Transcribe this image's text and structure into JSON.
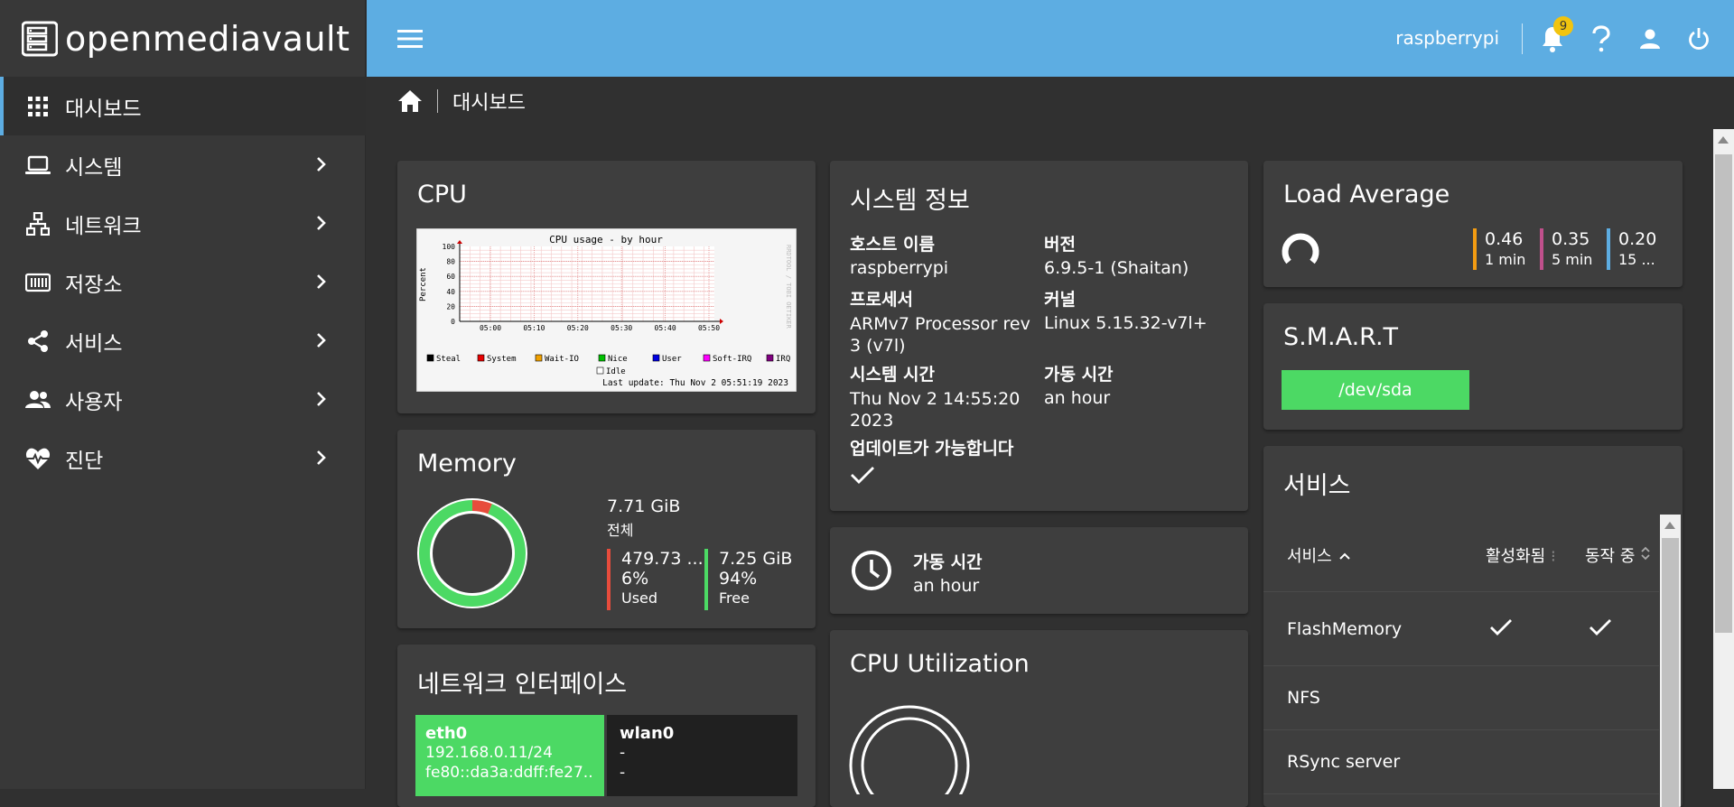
{
  "brand": {
    "name": "openmediavault"
  },
  "sidebar": {
    "items": [
      {
        "label": "대시보드",
        "icon": "grid-icon",
        "active": true,
        "chevron": false
      },
      {
        "label": "시스템",
        "icon": "laptop-icon",
        "chevron": true
      },
      {
        "label": "네트워크",
        "icon": "network-icon",
        "chevron": true
      },
      {
        "label": "저장소",
        "icon": "storage-icon",
        "chevron": true
      },
      {
        "label": "서비스",
        "icon": "share-icon",
        "chevron": true
      },
      {
        "label": "사용자",
        "icon": "users-icon",
        "chevron": true
      },
      {
        "label": "진단",
        "icon": "heartbeat-icon",
        "chevron": true
      }
    ]
  },
  "topbar": {
    "username": "raspberrypi",
    "notifications": "9"
  },
  "breadcrumb": {
    "page": "대시보드"
  },
  "cpu": {
    "title": "CPU",
    "graph_title": "CPU usage - by hour",
    "ylabel": "Percent",
    "side_label": "RRDTOOL / TOBI OETIKER",
    "last_update": "Last update: Thu Nov  2 05:51:19 2023",
    "legend": [
      {
        "name": "Steal",
        "color": "#000000"
      },
      {
        "name": "System",
        "color": "#e60000"
      },
      {
        "name": "Wait-IO",
        "color": "#f0a000"
      },
      {
        "name": "Nice",
        "color": "#00c000"
      },
      {
        "name": "User",
        "color": "#0000e0"
      },
      {
        "name": "Soft-IRQ",
        "color": "#ff00ff"
      },
      {
        "name": "IRQ",
        "color": "#800080"
      },
      {
        "name": "Idle",
        "color": "#ffffff"
      }
    ]
  },
  "chart_data": {
    "type": "area",
    "title": "CPU usage - by hour",
    "ylabel": "Percent",
    "ylim": [
      0,
      100
    ],
    "yticks": [
      "100",
      "80",
      "60",
      "40",
      "20",
      "0"
    ],
    "categories": [
      "05:00",
      "05:10",
      "05:20",
      "05:30",
      "05:40",
      "05:50"
    ],
    "grid": true,
    "legend": "bottom"
  },
  "memory": {
    "title": "Memory",
    "total_value": "7.71 GiB",
    "total_label": "전체",
    "used_value": "479.73 ...",
    "used_pct": "6%",
    "used_label": "Used",
    "free_value": "7.25 GiB",
    "free_pct": "94%",
    "free_label": "Free",
    "used_fraction": 0.06,
    "used_color": "#e74c3c",
    "free_color": "#4cd964"
  },
  "netif": {
    "title": "네트워크 인터페이스",
    "items": [
      {
        "name": "eth0",
        "line1": "192.168.0.11/24",
        "line2": "fe80::da3a:ddff:fe27...",
        "color": "#4cd964"
      },
      {
        "name": "wlan0",
        "line1": "-",
        "line2": "-",
        "color": "#202020"
      }
    ]
  },
  "sysinfo": {
    "title": "시스템 정보",
    "host_label": "호스트 이름",
    "host_value": "raspberrypi",
    "ver_label": "버전",
    "ver_value": "6.9.5-1 (Shaitan)",
    "proc_label": "프로세서",
    "proc_value1": "ARMv7 Processor rev",
    "proc_value2": "3 (v7l)",
    "kernel_label": "커널",
    "kernel_value": "Linux 5.15.32-v7l+",
    "time_label": "시스템 시간",
    "time_value1": "Thu Nov 2 14:55:20",
    "time_value2": "2023",
    "uptime_label": "가동 시간",
    "uptime_value": "an hour",
    "update_label": "업데이트가 가능합니다"
  },
  "uptime": {
    "label": "가동 시간",
    "value": "an hour"
  },
  "cpu_util": {
    "title": "CPU Utilization"
  },
  "load": {
    "title": "Load Average",
    "items": [
      {
        "value": "0.46",
        "label": "1 min",
        "color": "#f39c12"
      },
      {
        "value": "0.35",
        "label": "5 min",
        "color": "#c0508c"
      },
      {
        "value": "0.20",
        "label": "15 ...",
        "color": "#5dade2"
      }
    ]
  },
  "smart": {
    "title": "S.M.A.R.T",
    "device": "/dev/sda",
    "color": "#4cd964"
  },
  "services": {
    "title": "서비스",
    "col_service": "서비스",
    "col_enabled": "활성화됨",
    "col_running": "동작 중",
    "rows": [
      {
        "name": "FlashMemory",
        "enabled": true,
        "running": true
      },
      {
        "name": "NFS",
        "enabled": false,
        "running": false
      },
      {
        "name": "RSync server",
        "enabled": false,
        "running": false
      }
    ]
  }
}
